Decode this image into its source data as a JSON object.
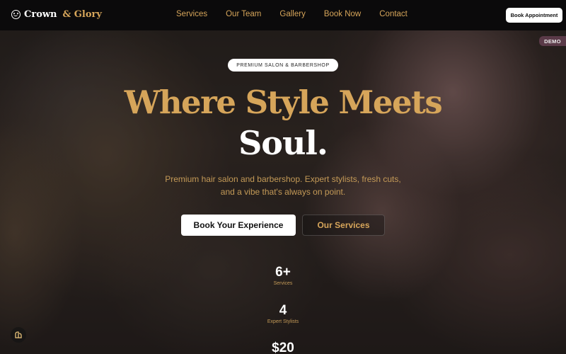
{
  "header": {
    "logo_name": "Crown",
    "logo_accent": "& Glory",
    "nav": [
      "Services",
      "Our Team",
      "Gallery",
      "Book Now",
      "Contact"
    ],
    "book_label": "Book Appointment"
  },
  "badge": {
    "demo": "DEMO"
  },
  "hero": {
    "tagline": "PREMIUM SALON & BARBERSHOP",
    "title_line1": "Where Style Meets",
    "title_line2": "Soul.",
    "subtitle_line1": "Premium hair salon and barbershop. Expert stylists, fresh cuts,",
    "subtitle_line2": "and a vibe that's always on point.",
    "primary_cta": "Book Your Experience",
    "secondary_cta": "Our Services"
  },
  "stats": [
    {
      "value": "6+",
      "label": "Services"
    },
    {
      "value": "4",
      "label": "Expert Stylists"
    },
    {
      "value": "$20",
      "label": ""
    }
  ],
  "colors": {
    "accent": "#d6a55a",
    "header_bg": "#0b0a0b",
    "demo_badge": "#5a3a48"
  },
  "icons": {
    "logo": "smiley-icon",
    "corner": "builder-badge-icon"
  }
}
